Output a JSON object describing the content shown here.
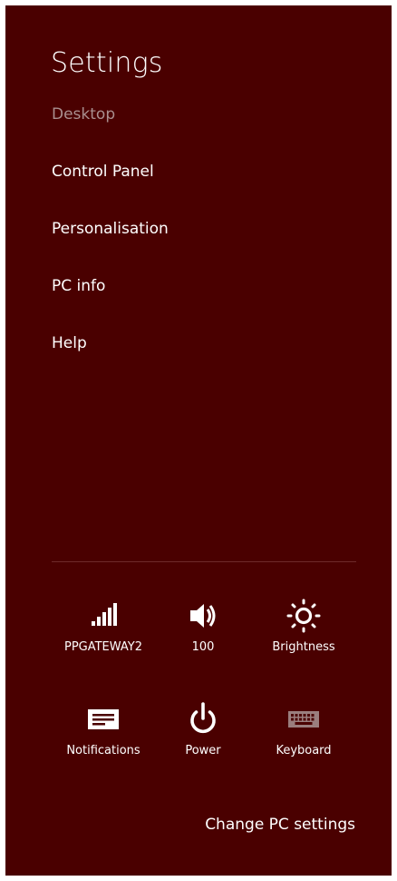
{
  "panel": {
    "title": "Settings",
    "subtitle": "Desktop",
    "background_color": "#4a0000"
  },
  "menu": {
    "items": [
      {
        "label": "Control Panel"
      },
      {
        "label": "Personalisation"
      },
      {
        "label": "PC info"
      },
      {
        "label": "Help"
      }
    ]
  },
  "quick_settings": {
    "network": {
      "label": "PPGATEWAY2",
      "icon": "wifi-signal-icon"
    },
    "volume": {
      "label": "100",
      "icon": "speaker-icon"
    },
    "brightness": {
      "label": "Brightness",
      "icon": "sun-icon"
    },
    "notifications": {
      "label": "Notifications",
      "icon": "notifications-icon"
    },
    "power": {
      "label": "Power",
      "icon": "power-icon"
    },
    "keyboard": {
      "label": "Keyboard",
      "icon": "keyboard-icon"
    }
  },
  "footer": {
    "change_settings_label": "Change PC settings"
  }
}
